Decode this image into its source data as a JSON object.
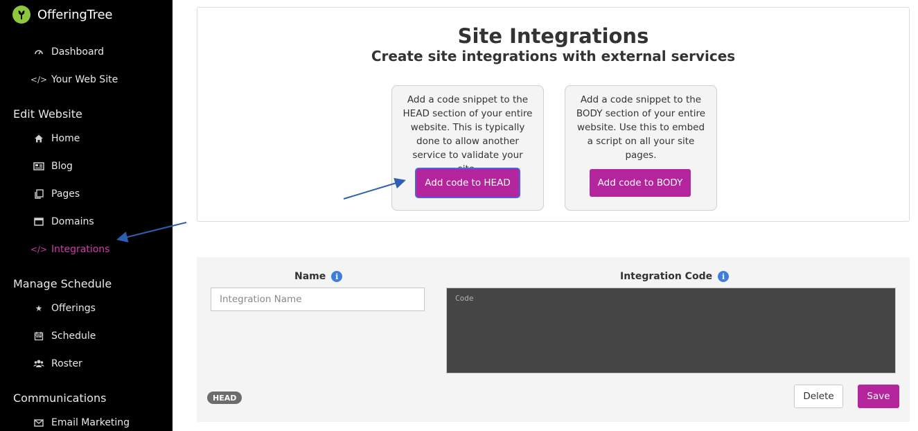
{
  "brand": {
    "name": "OfferingTree"
  },
  "sidebar": {
    "top_items": [
      {
        "label": "Dashboard",
        "icon": "dashboard-icon"
      },
      {
        "label": "Your Web Site",
        "icon": "code-icon"
      }
    ],
    "sections": [
      {
        "title": "Edit Website",
        "items": [
          {
            "label": "Home",
            "icon": "home-icon"
          },
          {
            "label": "Blog",
            "icon": "newspaper-icon"
          },
          {
            "label": "Pages",
            "icon": "pages-icon"
          },
          {
            "label": "Domains",
            "icon": "window-icon"
          },
          {
            "label": "Integrations",
            "icon": "code-icon",
            "active": true
          }
        ]
      },
      {
        "title": "Manage Schedule",
        "items": [
          {
            "label": "Offerings",
            "icon": "star-icon"
          },
          {
            "label": "Schedule",
            "icon": "calendar-icon"
          },
          {
            "label": "Roster",
            "icon": "users-icon"
          }
        ]
      },
      {
        "title": "Communications",
        "items": [
          {
            "label": "Email Marketing",
            "icon": "envelope-icon"
          }
        ]
      }
    ]
  },
  "main": {
    "title": "Site Integrations",
    "subtitle": "Create site integrations with external services",
    "head_option": {
      "text": "Add a code snippet to the HEAD section of your entire website. This is typically done to allow another service to validate your site.",
      "button": "Add code to HEAD"
    },
    "body_option": {
      "text": "Add a code snippet to the BODY section of your entire website. Use this to embed a script on all your site pages.",
      "button": "Add code to BODY"
    }
  },
  "form": {
    "name_label": "Name",
    "name_placeholder": "Integration Name",
    "code_label": "Integration Code",
    "code_placeholder": "Code",
    "section_badge": "HEAD",
    "delete_label": "Delete",
    "save_label": "Save",
    "info_glyph": "i"
  },
  "colors": {
    "accent": "#b3249d",
    "active_nav": "#d13aad",
    "annotation_arrow": "#2f5fb3",
    "info": "#3d7de0",
    "brand_logo": "#8dc63f"
  }
}
